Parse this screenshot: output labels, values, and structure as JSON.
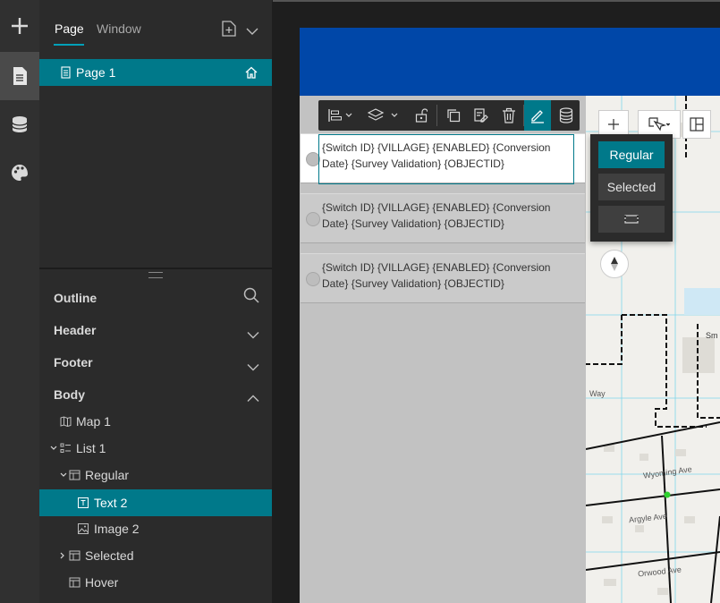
{
  "panel": {
    "tabs": [
      {
        "label": "Page"
      },
      {
        "label": "Window"
      }
    ],
    "page_item": "Page 1"
  },
  "outline": {
    "title": "Outline",
    "sections": [
      {
        "label": "Header"
      },
      {
        "label": "Footer"
      },
      {
        "label": "Body"
      }
    ],
    "tree": [
      {
        "label": "Map 1"
      },
      {
        "label": "List 1"
      },
      {
        "label": "Regular"
      },
      {
        "label": "Text 2"
      },
      {
        "label": "Image 2"
      },
      {
        "label": "Selected"
      },
      {
        "label": "Hover"
      }
    ]
  },
  "list": {
    "cards": [
      {
        "text": "{Switch ID} {VILLAGE} {ENABLED} {Conversion Date} {Survey Validation} {OBJECTID}"
      },
      {
        "text": "{Switch ID} {VILLAGE} {ENABLED} {Conversion Date} {Survey Validation} {OBJECTID}"
      },
      {
        "text": "{Switch ID} {VILLAGE} {ENABLED} {Conversion Date} {Survey Validation} {OBJECTID}"
      }
    ]
  },
  "states": {
    "regular": "Regular",
    "selected": "Selected"
  },
  "map": {
    "labels": [
      "Sm",
      "Way",
      "Wyoming Ave",
      "Argyle Ave",
      "Orwood Ave"
    ]
  },
  "colors": {
    "accent": "#00798a",
    "app_header": "#0047a8"
  }
}
